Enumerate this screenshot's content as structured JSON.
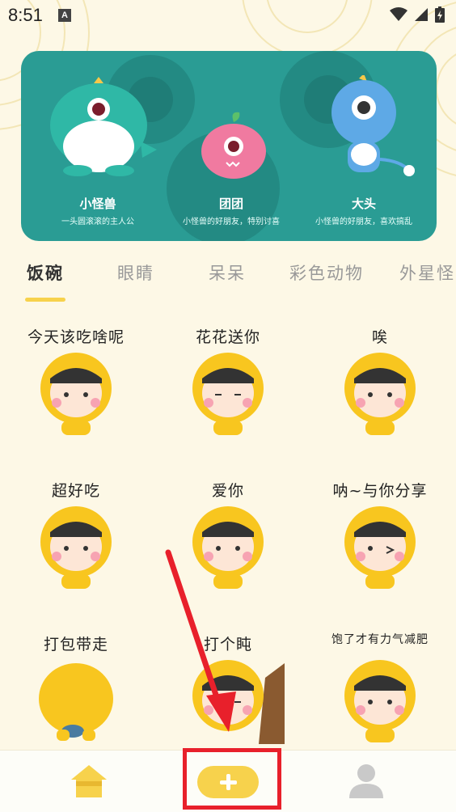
{
  "status_bar": {
    "time": "8:51",
    "notification_icon": "A"
  },
  "banner": {
    "characters": [
      {
        "name": "小怪兽",
        "desc": "一头圆滚滚的主人公"
      },
      {
        "name": "团团",
        "desc": "小怪兽的好朋友，特别讨喜"
      },
      {
        "name": "大头",
        "desc": "小怪兽的好朋友，喜欢搞乱"
      }
    ]
  },
  "tabs": [
    {
      "label": "饭碗",
      "active": true
    },
    {
      "label": "眼睛",
      "active": false
    },
    {
      "label": "呆呆",
      "active": false
    },
    {
      "label": "彩色动物",
      "active": false
    },
    {
      "label": "外星怪",
      "active": false
    }
  ],
  "stickers": [
    {
      "caption": "今天该吃啥呢"
    },
    {
      "caption": "花花送你"
    },
    {
      "caption": "唉"
    },
    {
      "caption": "超好吃"
    },
    {
      "caption": "爱你"
    },
    {
      "caption": "呐~与你分享"
    },
    {
      "caption": "打包带走"
    },
    {
      "caption": "打个盹"
    },
    {
      "caption": "饱了才有力气减肥"
    }
  ],
  "bottom_nav": {
    "home_icon": "home-icon",
    "add_icon": "plus-icon",
    "profile_icon": "user-icon"
  },
  "colors": {
    "accent": "#f7d24c",
    "banner": "#2a9c94",
    "highlight": "#e8202b"
  }
}
